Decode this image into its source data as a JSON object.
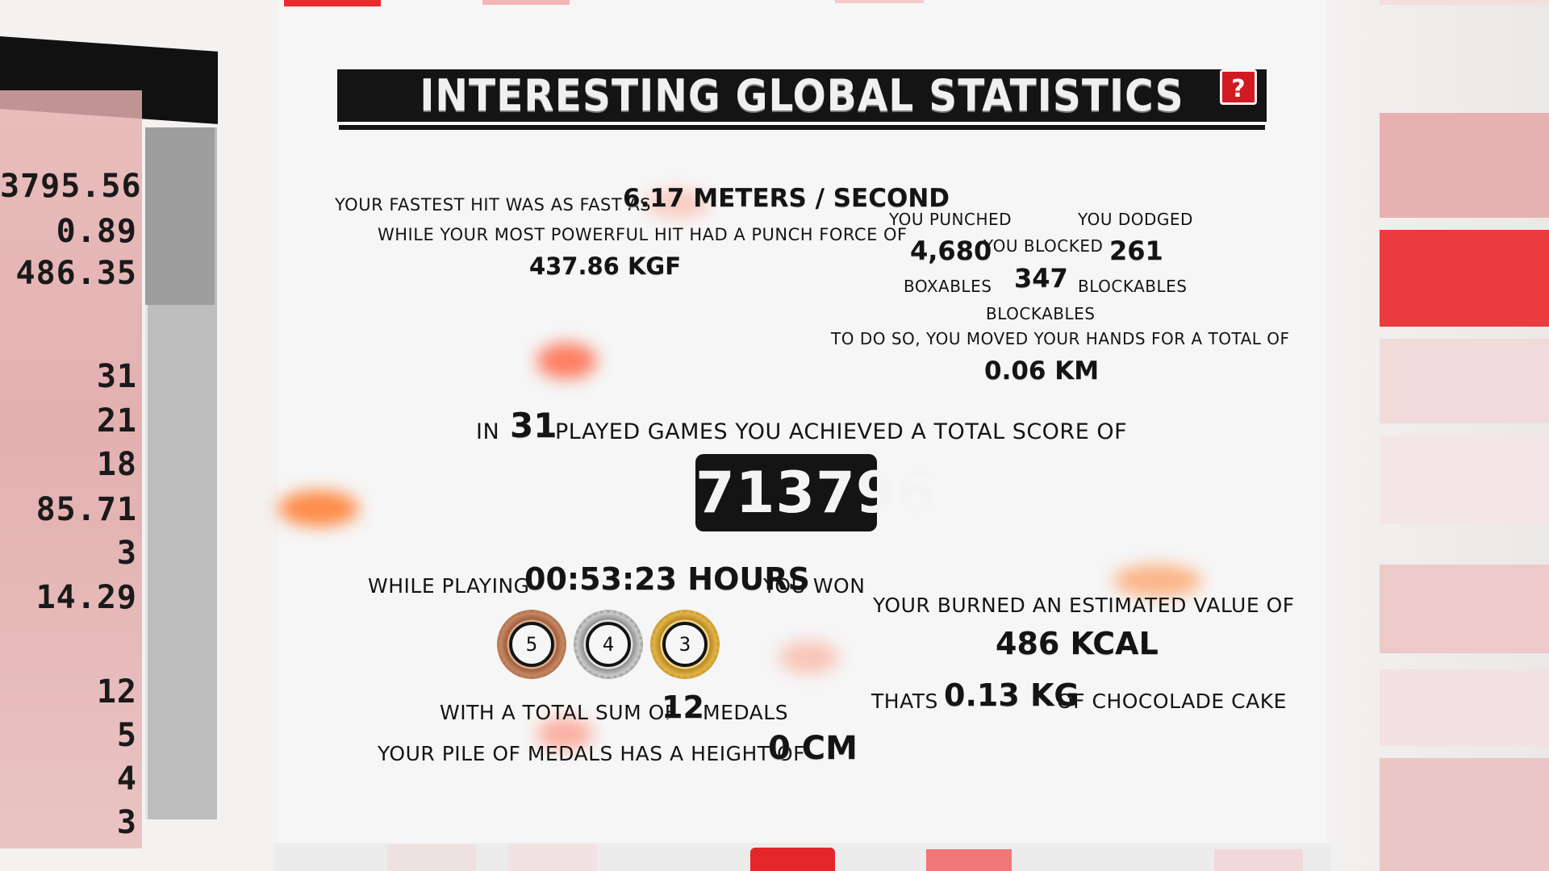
{
  "colors": {
    "accent_red": "#d21a22",
    "title_bar": "#141414",
    "panel": "#f6f6f6",
    "side_values_bg": "#e2a9a9"
  },
  "side_panel": {
    "values": [
      "3795.56",
      "0.89",
      "486.35",
      "31",
      "21",
      "18",
      "85.71",
      "3",
      "14.29",
      "12",
      "5",
      "4",
      "3"
    ]
  },
  "header": {
    "title": "INTERESTING GLOBAL STATISTICS",
    "help_label": "?",
    "help_icon": "question-mark-icon"
  },
  "hits": {
    "fastest_label": "YOUR FASTEST HIT WAS AS FAST AS",
    "fastest_value": "6.17 METERS / SECOND",
    "powerful_label": "WHILE YOUR MOST POWERFUL HIT HAD A PUNCH FORCE OF",
    "powerful_value": "437.86 KGF"
  },
  "actions": {
    "punched_label": "YOU PUNCHED",
    "punched_value": "4,680",
    "punched_unit": "BOXABLES",
    "blocked_label": "YOU BLOCKED",
    "blocked_value": "347",
    "blocked_unit": "BLOCKABLES",
    "dodged_label": "YOU DODGED",
    "dodged_value": "261",
    "dodged_unit": "BLOCKABLES",
    "distance_label": "TO DO SO, YOU MOVED YOUR HANDS FOR A TOTAL OF",
    "distance_value": "0.06 KM"
  },
  "games": {
    "prefix": "IN",
    "played_value": "31",
    "suffix": "PLAYED GAMES YOU ACHIEVED A TOTAL SCORE OF",
    "total_score": "713796"
  },
  "time": {
    "prefix": "WHILE PLAYING",
    "value": "00:53:23 HOURS",
    "suffix": "YOU WON"
  },
  "medals": {
    "bronze": "5",
    "silver": "4",
    "gold": "3",
    "sum_prefix": "WITH A TOTAL SUM OF",
    "sum_value": "12",
    "sum_suffix": "MEDALS",
    "pile_label": "YOUR PILE OF MEDALS HAS A HEIGHT OF",
    "pile_value": "0 CM"
  },
  "calories": {
    "label": "YOUR BURNED AN ESTIMATED VALUE OF",
    "value": "486 KCAL",
    "cake_prefix": "THATS",
    "cake_value": "0.13 KG",
    "cake_suffix": "OF CHOCOLADE CAKE"
  }
}
